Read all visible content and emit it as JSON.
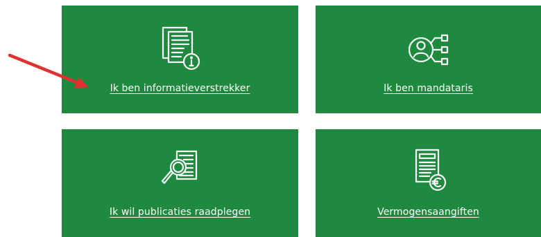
{
  "tiles": [
    {
      "label": "Ik ben informatieverstrekker",
      "icon": "document-info-icon"
    },
    {
      "label": "Ik ben mandataris",
      "icon": "person-network-icon"
    },
    {
      "label": "Ik wil publicaties raadplegen",
      "icon": "search-document-icon"
    },
    {
      "label": "Vermogensaangiften",
      "icon": "document-euro-icon"
    }
  ],
  "colors": {
    "tile_bg": "#1f8a3f",
    "arrow": "#e03131",
    "text": "#ffffff"
  }
}
